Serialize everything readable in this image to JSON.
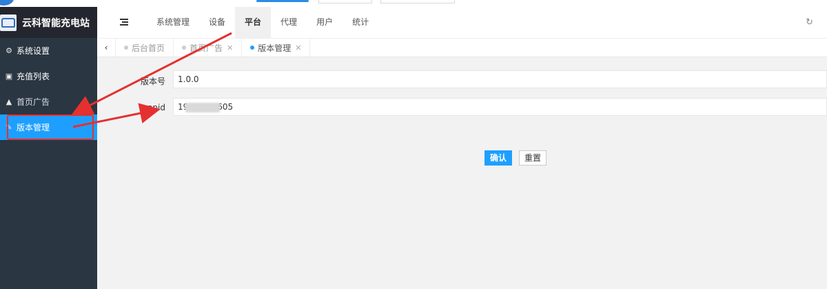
{
  "brand": {
    "title": "云科智能充电站"
  },
  "sidebar": {
    "items": [
      {
        "label": "系统设置",
        "icon": "gears-icon"
      },
      {
        "label": "充值列表",
        "icon": "money-icon"
      },
      {
        "label": "首页广告",
        "icon": "tree-icon"
      },
      {
        "label": "版本管理",
        "icon": "edit-icon",
        "active": true
      }
    ]
  },
  "header": {
    "menu": [
      "系统管理",
      "设备",
      "平台",
      "代理",
      "用户",
      "统计"
    ],
    "active_menu": "平台"
  },
  "tabs": [
    {
      "label": "后台首页",
      "closable": false
    },
    {
      "label": "首页广告",
      "closable": true
    },
    {
      "label": "版本管理",
      "closable": true,
      "active": true
    }
  ],
  "form": {
    "version_label": "版本号",
    "version_value": "1.0.0",
    "appid_label": "appid",
    "appid_value": "19           605"
  },
  "buttons": {
    "confirm": "确认",
    "reset": "重置"
  },
  "colors": {
    "accent": "#1e9fff",
    "sidebar": "#2a3642",
    "annotation": "#e53030"
  }
}
